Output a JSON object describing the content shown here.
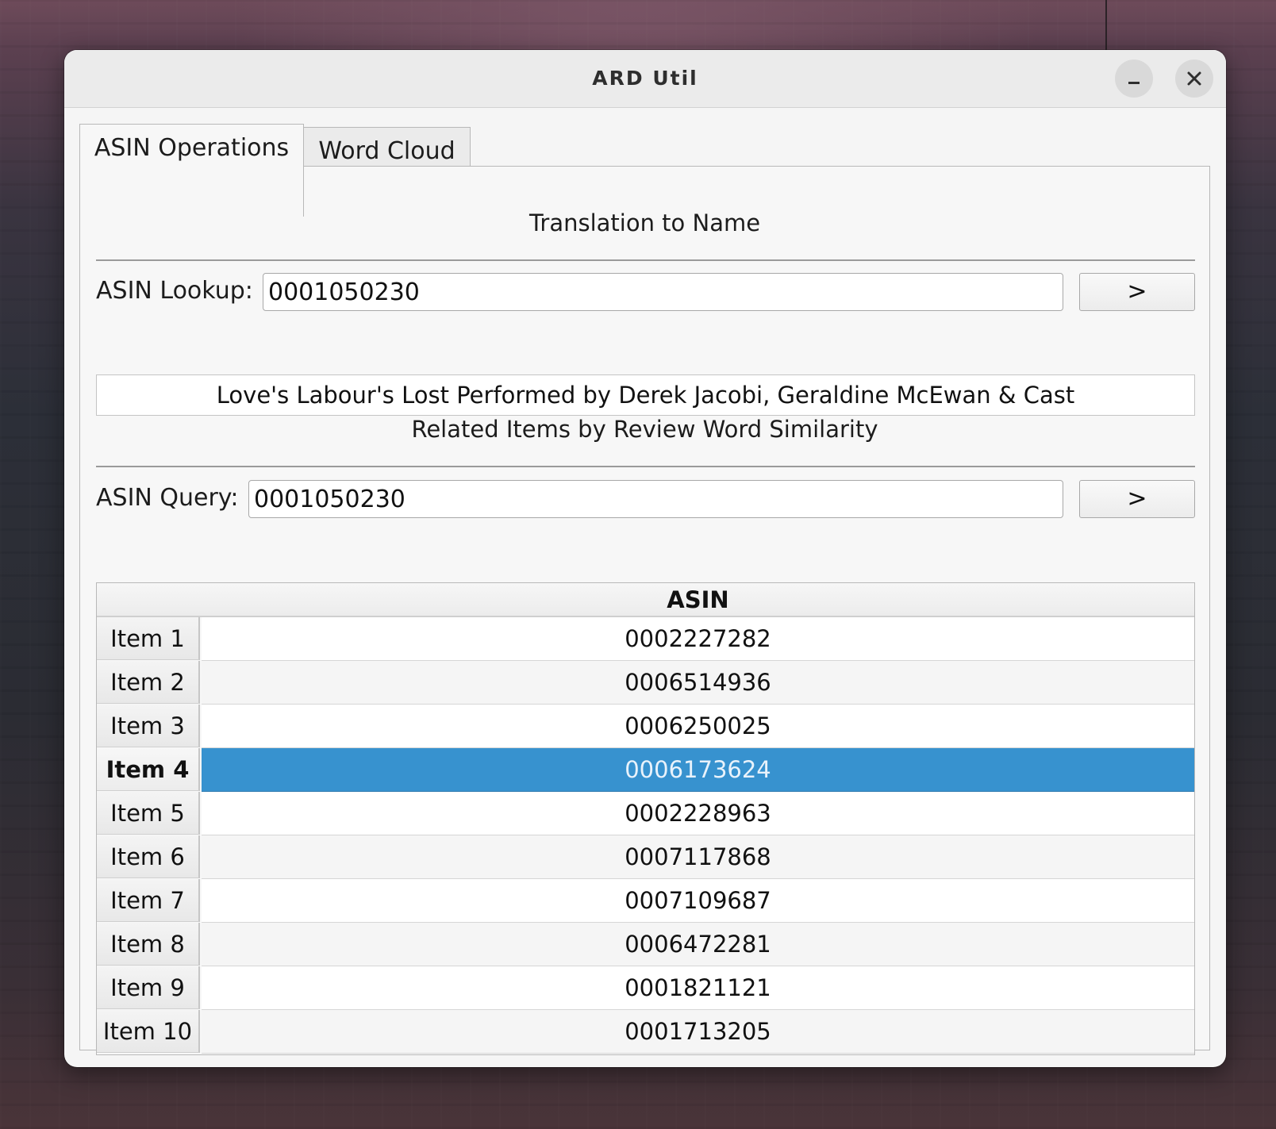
{
  "window": {
    "title": "ARD Util",
    "minimize_glyph": "–",
    "close_glyph": "✕"
  },
  "tabs": [
    {
      "label": "ASIN Operations",
      "active": true
    },
    {
      "label": "Word Cloud",
      "active": false
    }
  ],
  "translation": {
    "heading": "Translation to Name",
    "lookup_label": "ASIN Lookup:",
    "lookup_value": "0001050230",
    "go_label": ">",
    "result": "Love's Labour's Lost Performed by Derek Jacobi, Geraldine McEwan & Cast"
  },
  "related": {
    "heading": "Related Items by Review Word Similarity",
    "query_label": "ASIN Query:",
    "query_value": "0001050230",
    "go_label": ">"
  },
  "table": {
    "column_header": "ASIN",
    "selected_index": 3,
    "selection_color": "#3792cf",
    "rows": [
      {
        "label": "Item 1",
        "asin": "0002227282"
      },
      {
        "label": "Item 2",
        "asin": "0006514936"
      },
      {
        "label": "Item 3",
        "asin": "0006250025"
      },
      {
        "label": "Item 4",
        "asin": "0006173624"
      },
      {
        "label": "Item 5",
        "asin": "0002228963"
      },
      {
        "label": "Item 6",
        "asin": "0007117868"
      },
      {
        "label": "Item 7",
        "asin": "0007109687"
      },
      {
        "label": "Item 8",
        "asin": "0006472281"
      },
      {
        "label": "Item 9",
        "asin": "0001821121"
      },
      {
        "label": "Item 10",
        "asin": "0001713205"
      }
    ]
  }
}
